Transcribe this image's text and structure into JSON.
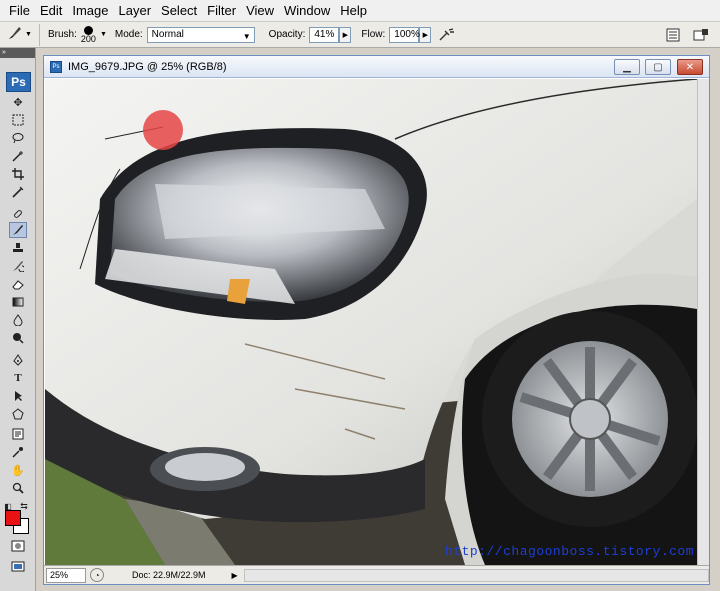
{
  "menu": {
    "items": [
      "File",
      "Edit",
      "Image",
      "Layer",
      "Select",
      "Filter",
      "View",
      "Window",
      "Help"
    ]
  },
  "options_bar": {
    "brush_label": "Brush:",
    "brush_size": "200",
    "mode_label": "Mode:",
    "mode_value": "Normal",
    "opacity_label": "Opacity:",
    "opacity_value": "41%",
    "flow_label": "Flow:",
    "flow_value": "100%",
    "icons": [
      "brush-tool-icon",
      "airbrush-icon",
      "palette-well-icon",
      "workspace-icon"
    ]
  },
  "toolbox": {
    "logo": "Ps",
    "foreground_color": "#e81212",
    "background_color": "#ffffff"
  },
  "document": {
    "title": "IMG_9679.JPG @ 25% (RGB/8)",
    "icon_label": "Ps",
    "zoom": "25%",
    "doc_size": "Doc: 22.9M/22.9M",
    "watermark": "http://chagoonboss.tistory.com"
  }
}
